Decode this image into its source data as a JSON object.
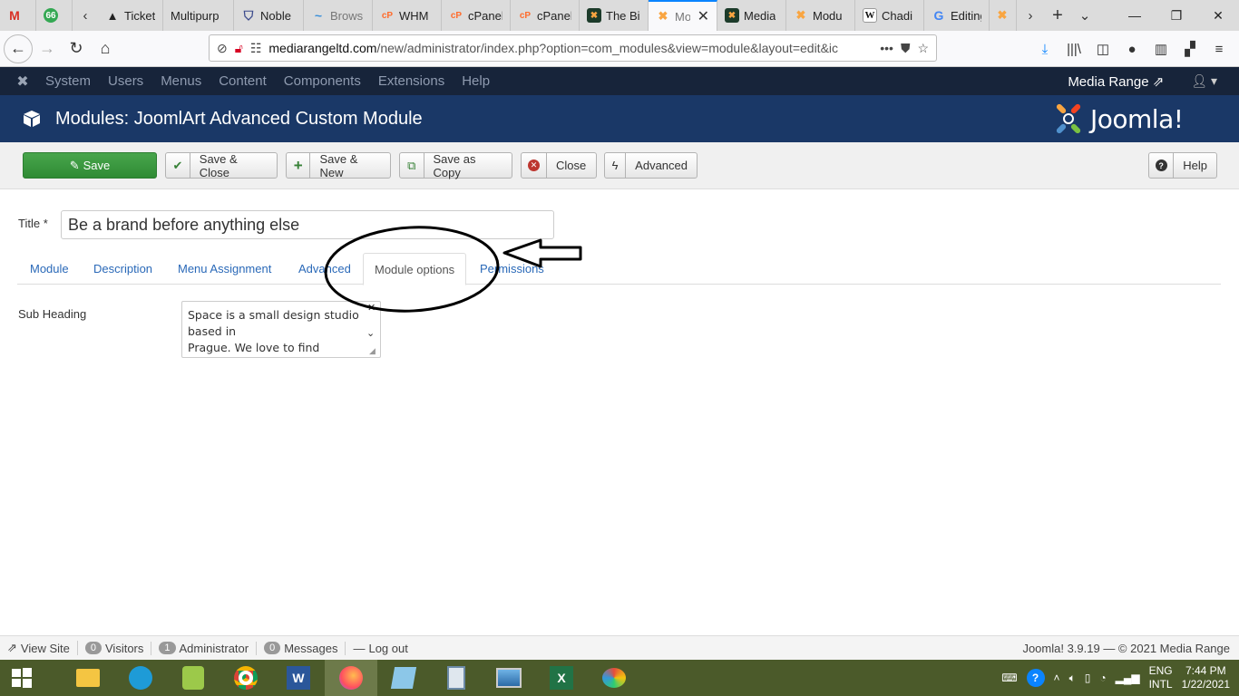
{
  "browser": {
    "tabs": [
      {
        "label": "",
        "favicon": "M",
        "color": "#d93025"
      },
      {
        "label": "",
        "favicon": "66",
        "color": "#34a853"
      },
      {
        "label": "Ticket",
        "favicon": "▲",
        "color": "#222222"
      },
      {
        "label": "Multipurp",
        "favicon": "",
        "color": "#dcdcdc"
      },
      {
        "label": "Noble",
        "favicon": "⛉",
        "color": "#3b4a8c"
      },
      {
        "label": "Brows",
        "favicon": "~",
        "color": "#3a8fd9"
      },
      {
        "label": "WHM",
        "favicon": "cP",
        "color": "#ff6c2c"
      },
      {
        "label": "cPanel",
        "favicon": "cP",
        "color": "#ff6c2c"
      },
      {
        "label": "cPanel",
        "favicon": "cP",
        "color": "#ff6c2c"
      },
      {
        "label": "The Bi",
        "favicon": "✖",
        "color": "#1c3b2a"
      },
      {
        "label": "Mo",
        "favicon": "✖",
        "color": "#f9a541",
        "active": true
      },
      {
        "label": "Media",
        "favicon": "✖",
        "color": "#1c3b2a"
      },
      {
        "label": "Modu",
        "favicon": "✖",
        "color": "#f9a541"
      },
      {
        "label": "Chadi",
        "favicon": "W",
        "color": "#ffffff"
      },
      {
        "label": "Editing",
        "favicon": "G",
        "color": "#4285f4"
      },
      {
        "label": "",
        "favicon": "✖",
        "color": "#f9a541"
      }
    ],
    "url_host": "mediarangeltd.com",
    "url_path": "/new/administrator/index.php?option=com_modules&view=module&layout=edit&ic"
  },
  "admin_nav": {
    "menus": [
      "System",
      "Users",
      "Menus",
      "Content",
      "Components",
      "Extensions",
      "Help"
    ],
    "site_name": "Media Range"
  },
  "header": {
    "title": "Modules: JoomlArt Advanced Custom Module",
    "brand": "Joomla!"
  },
  "toolbar": {
    "save": "Save",
    "save_close": "Save & Close",
    "save_new": "Save & New",
    "save_copy": "Save as Copy",
    "close": "Close",
    "advanced": "Advanced",
    "help": "Help"
  },
  "form": {
    "title_label": "Title *",
    "title_value": "Be a brand before anything else",
    "tabs": [
      "Module",
      "Description",
      "Menu Assignment",
      "Advanced",
      "Module options",
      "Permissions"
    ],
    "active_tab": "Module options",
    "sub_heading_label": "Sub Heading",
    "sub_heading_value": "Space is a small design studio based in\nPrague. We love to find simple"
  },
  "status": {
    "view_site": "View Site",
    "visitors_count": "0",
    "visitors": "Visitors",
    "admin_count": "1",
    "admin": "Administrator",
    "messages_count": "0",
    "messages": "Messages",
    "logout": "Log out",
    "version": "Joomla! 3.9.19 — © 2021 Media Range"
  },
  "taskbar": {
    "lang1": "ENG",
    "lang2": "INTL",
    "time": "7:44 PM",
    "date": "1/22/2021"
  }
}
